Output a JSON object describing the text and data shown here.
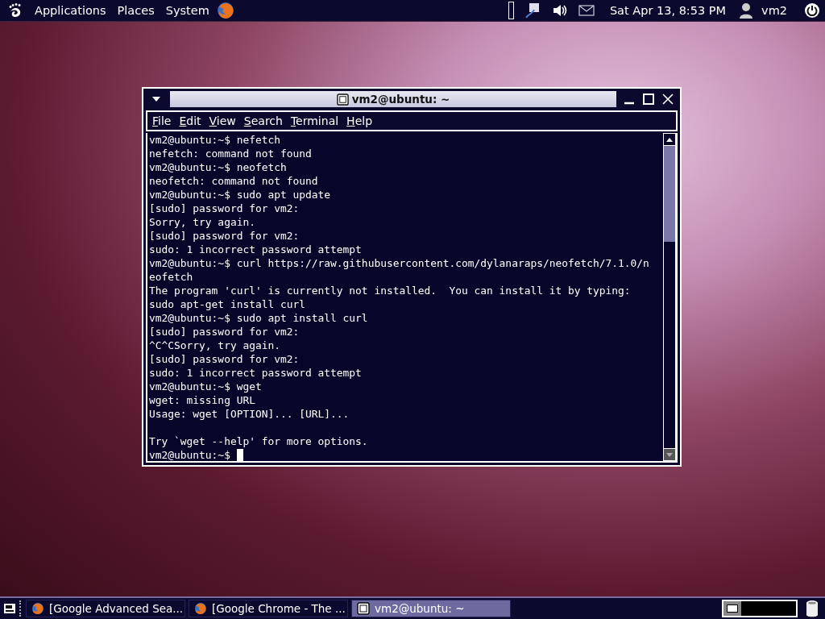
{
  "top_panel": {
    "menus": [
      "Applications",
      "Places",
      "System"
    ],
    "clock": "Sat Apr 13, 8:53 PM",
    "user": "vm2"
  },
  "window": {
    "title": "vm2@ubuntu: ~",
    "menu": [
      "File",
      "Edit",
      "View",
      "Search",
      "Terminal",
      "Help"
    ],
    "lines": [
      {
        "text": "vm2@ubuntu:~$ nefetch"
      },
      {
        "text": "nefetch: command not found"
      },
      {
        "text": "vm2@ubuntu:~$ neofetch"
      },
      {
        "text": "neofetch: command not found"
      },
      {
        "text": "vm2@ubuntu:~$ sudo apt update"
      },
      {
        "text": "[sudo] password for vm2:"
      },
      {
        "text": "Sorry, try again."
      },
      {
        "text": "[sudo] password for vm2:"
      },
      {
        "text": "sudo: 1 incorrect password attempt"
      },
      {
        "text": "vm2@ubuntu:~$ curl https://raw.githubusercontent.com/dylanaraps/neofetch/7.1.0/n"
      },
      {
        "text": "eofetch"
      },
      {
        "text": "The program 'curl' is currently not installed.  You can install it by typing:"
      },
      {
        "text": "sudo apt-get install curl"
      },
      {
        "text": "vm2@ubuntu:~$ sudo apt install curl"
      },
      {
        "text": "[sudo] password for vm2:"
      },
      {
        "text": "^C^CSorry, try again."
      },
      {
        "text": "[sudo] password for vm2:"
      },
      {
        "text": "sudo: 1 incorrect password attempt"
      },
      {
        "text": "vm2@ubuntu:~$ wget"
      },
      {
        "text": "wget: missing URL"
      },
      {
        "text": "Usage: wget [OPTION]... [URL]..."
      },
      {
        "text": "Try `wget --help' for more options.",
        "blank_before": true
      },
      {
        "text": "vm2@ubuntu:~$",
        "cursor": true
      }
    ]
  },
  "taskbar": [
    {
      "label": "[Google Advanced Sea...",
      "kind": "browser",
      "selected": false
    },
    {
      "label": "[Google Chrome - The ...",
      "kind": "browser",
      "selected": false
    },
    {
      "label": "vm2@ubuntu: ~",
      "kind": "terminal",
      "selected": true
    }
  ]
}
